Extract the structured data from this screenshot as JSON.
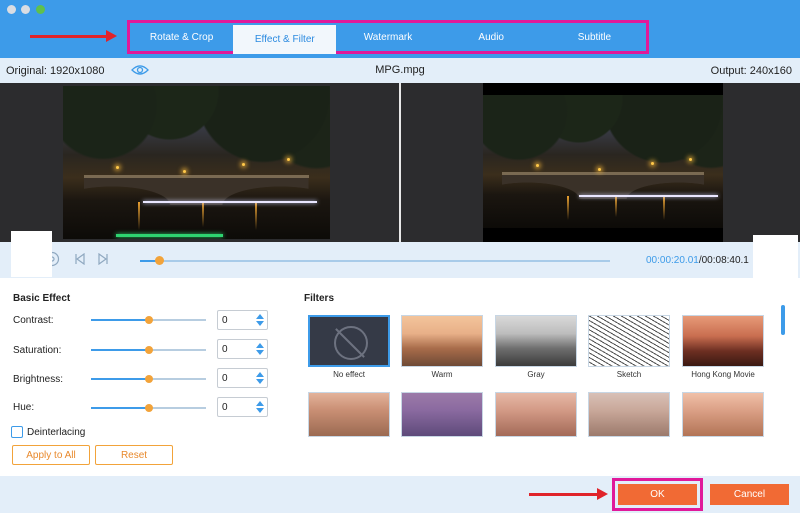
{
  "tabs": [
    {
      "label": "Rotate & Crop",
      "active": false
    },
    {
      "label": "Effect & Filter",
      "active": true
    },
    {
      "label": "Watermark",
      "active": false
    },
    {
      "label": "Audio",
      "active": false
    },
    {
      "label": "Subtitle",
      "active": false
    }
  ],
  "info": {
    "original": "Original: 1920x1080",
    "filename": "MPG.mpg",
    "output": "Output: 240x160"
  },
  "playback": {
    "current_time": "00:00:20.01",
    "total_time": "/00:08:40.1",
    "progress": 0.04
  },
  "basic_effect": {
    "heading": "Basic Effect",
    "controls": [
      {
        "label": "Contrast:",
        "value": "0",
        "level": 0.5
      },
      {
        "label": "Saturation:",
        "value": "0",
        "level": 0.5
      },
      {
        "label": "Brightness:",
        "value": "0",
        "level": 0.5
      },
      {
        "label": "Hue:",
        "value": "0",
        "level": 0.5
      }
    ],
    "deinterlacing": "Deinterlacing",
    "deinterlacing_checked": false,
    "apply_to_all": "Apply to All",
    "reset": "Reset"
  },
  "filters": {
    "heading": "Filters",
    "items": [
      {
        "label": "No effect"
      },
      {
        "label": "Warm"
      },
      {
        "label": "Gray"
      },
      {
        "label": "Sketch"
      },
      {
        "label": "Hong Kong Movie"
      }
    ],
    "selected": "No effect"
  },
  "footer": {
    "ok": "OK",
    "cancel": "Cancel"
  },
  "colors": {
    "accent": "#3d9be9",
    "orange": "#f16a34",
    "highlight": "#e0199a",
    "arrow": "#e0232a"
  }
}
